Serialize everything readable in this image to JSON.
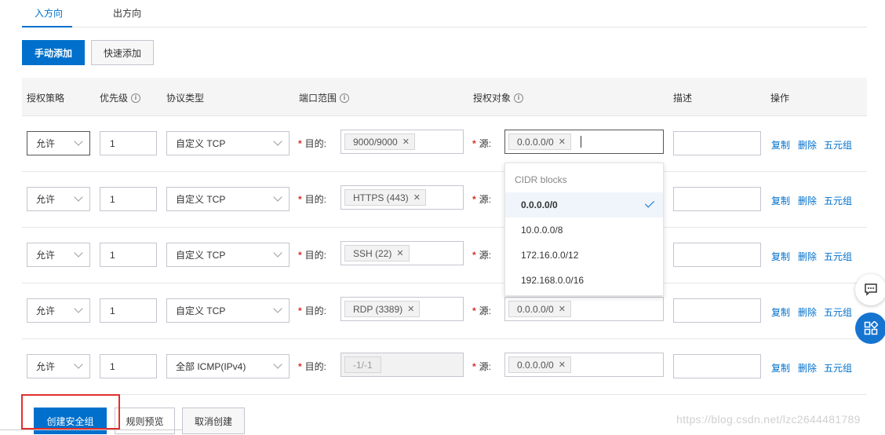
{
  "tabs": [
    {
      "label": "入方向",
      "active": true
    },
    {
      "label": "出方向",
      "active": false
    }
  ],
  "actions": {
    "manual_add": "手动添加",
    "quick_add": "快速添加"
  },
  "columns": {
    "policy": "授权策略",
    "priority": "优先级",
    "protocol": "协议类型",
    "port_range": "端口范围",
    "auth_object": "授权对象",
    "description": "描述",
    "operations": "操作"
  },
  "labels": {
    "dest": "目的:",
    "src": "源:",
    "required_mark": "*"
  },
  "row_actions": {
    "copy": "复制",
    "delete": "删除",
    "five_tuple": "五元组"
  },
  "rows": [
    {
      "policy": "允许",
      "priority": "1",
      "protocol": "自定义 TCP",
      "port": "9000/9000",
      "source": "0.0.0.0/0",
      "desc": ""
    },
    {
      "policy": "允许",
      "priority": "1",
      "protocol": "自定义 TCP",
      "port": "HTTPS (443)",
      "source": "",
      "desc": ""
    },
    {
      "policy": "允许",
      "priority": "1",
      "protocol": "自定义 TCP",
      "port": "SSH (22)",
      "source": "",
      "desc": ""
    },
    {
      "policy": "允许",
      "priority": "1",
      "protocol": "自定义 TCP",
      "port": "RDP (3389)",
      "source": "0.0.0.0/0",
      "desc": ""
    },
    {
      "policy": "允许",
      "priority": "1",
      "protocol": "全部 ICMP(IPv4)",
      "port": "-1/-1",
      "source": "0.0.0.0/0",
      "desc": ""
    }
  ],
  "dropdown": {
    "group_label": "CIDR blocks",
    "options": [
      "0.0.0.0/0",
      "10.0.0.0/8",
      "172.16.0.0/12",
      "192.168.0.0/16"
    ],
    "selected": "0.0.0.0/0"
  },
  "footer": {
    "create": "创建安全组",
    "preview": "规则预览",
    "cancel": "取消创建"
  },
  "watermark": "https://blog.csdn.net/lzc2644481789",
  "colors": {
    "accent": "#0070cc",
    "required": "#d93026",
    "highlight_box": "#e0302e"
  },
  "icons": {
    "info": "info-icon",
    "chat": "chat-icon",
    "apps": "apps-icon",
    "check": "check-icon",
    "close": "close-icon",
    "chevron": "chevron-down-icon"
  }
}
